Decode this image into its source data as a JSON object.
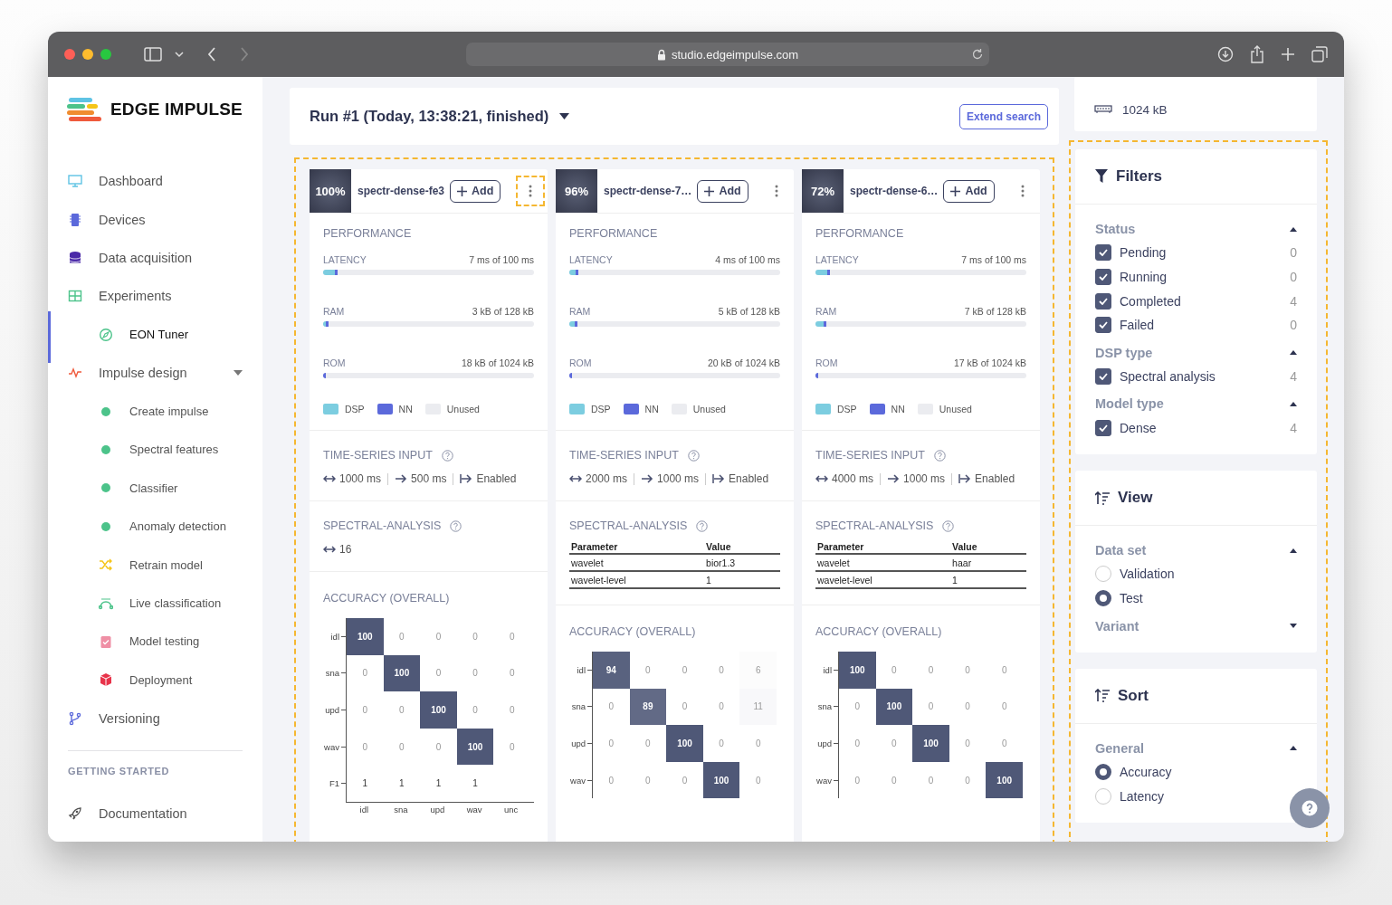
{
  "browser": {
    "url": "studio.edgeimpulse.com"
  },
  "sidebar": {
    "logo": "EDGE IMPULSE",
    "items": [
      {
        "label": "Dashboard",
        "selected": false
      },
      {
        "label": "Devices",
        "selected": false
      },
      {
        "label": "Data acquisition",
        "selected": false
      },
      {
        "label": "Experiments",
        "selected": false,
        "children": [
          {
            "label": "EON Tuner",
            "selected": true
          }
        ]
      },
      {
        "label": "Impulse design",
        "selected": false,
        "expanded": true,
        "children": [
          {
            "label": "Create impulse",
            "selected": false
          },
          {
            "label": "Spectral features",
            "selected": false
          },
          {
            "label": "Classifier",
            "selected": false
          },
          {
            "label": "Anomaly detection",
            "selected": false
          },
          {
            "label": "Retrain model",
            "selected": false
          },
          {
            "label": "Live classification",
            "selected": false
          },
          {
            "label": "Model testing",
            "selected": false
          },
          {
            "label": "Deployment",
            "selected": false
          }
        ]
      },
      {
        "label": "Versioning",
        "selected": false
      }
    ],
    "section_title": "GETTING STARTED",
    "footer_items": [
      {
        "label": "Documentation",
        "selected": false
      }
    ]
  },
  "header": {
    "run_title": "Run #1 (Today, 13:38:21, finished)",
    "extend_button": "Extend search"
  },
  "results": {
    "highlighted": true,
    "cards": [
      {
        "score": "100%",
        "name": "spectr-dense-fe3",
        "add": "Add",
        "menu_highlighted": true,
        "performance": {
          "title": "PERFORMANCE",
          "metrics": [
            {
              "label": "LATENCY",
              "reading": "7 ms of 100 ms",
              "segments": [
                {
                  "kind": "dsp",
                  "level": 0.055
                },
                {
                  "kind": "nn",
                  "level": 0.012
                }
              ]
            },
            {
              "label": "RAM",
              "reading": "3 kB of 128 kB",
              "segments": [
                {
                  "kind": "dsp",
                  "level": 0.004
                },
                {
                  "kind": "nn",
                  "level": 0.01
                }
              ]
            },
            {
              "label": "ROM",
              "reading": "18 kB of 1024 kB",
              "segments": [
                {
                  "kind": "nn",
                  "level": 0.012
                }
              ]
            }
          ],
          "legend": [
            {
              "label": "DSP",
              "color": "#7ccde0"
            },
            {
              "label": "NN",
              "color": "#5b69db"
            },
            {
              "label": "Unused",
              "color": "#ebecf0"
            }
          ]
        },
        "time_series": {
          "title": "TIME-SERIES INPUT",
          "items": [
            {
              "kind": "window",
              "text": "1000 ms"
            },
            {
              "kind": "stride",
              "text": "500 ms"
            },
            {
              "kind": "flag",
              "text": "Enabled"
            }
          ]
        },
        "spectral": {
          "title": "SPECTRAL-ANALYSIS",
          "kind": "value",
          "value": "16"
        },
        "accuracy": {
          "title": "ACCURACY (OVERALL)",
          "x_axis_labels": [
            "idl",
            "sna",
            "upd",
            "wav",
            "unc"
          ],
          "rows": [
            {
              "label": "idl",
              "kind": "class",
              "cells": [
                "100",
                "0",
                "0",
                "0",
                "0"
              ]
            },
            {
              "label": "sna",
              "kind": "class",
              "cells": [
                "0",
                "100",
                "0",
                "0",
                "0"
              ]
            },
            {
              "label": "upd",
              "kind": "class",
              "cells": [
                "0",
                "0",
                "100",
                "0",
                "0"
              ]
            },
            {
              "label": "wav",
              "kind": "class",
              "cells": [
                "0",
                "0",
                "0",
                "100",
                "0"
              ]
            },
            {
              "label": "F1",
              "kind": "f1",
              "cells": [
                "1",
                "1",
                "1",
                "1"
              ]
            }
          ]
        }
      },
      {
        "score": "96%",
        "name": "spectr-dense-7…",
        "add": "Add",
        "menu_highlighted": false,
        "performance": {
          "title": "PERFORMANCE",
          "metrics": [
            {
              "label": "LATENCY",
              "reading": "4 ms of 100 ms",
              "segments": [
                {
                  "kind": "dsp",
                  "level": 0.03
                },
                {
                  "kind": "nn",
                  "level": 0.01
                }
              ]
            },
            {
              "label": "RAM",
              "reading": "5 kB of 128 kB",
              "segments": [
                {
                  "kind": "dsp",
                  "level": 0.025
                },
                {
                  "kind": "nn",
                  "level": 0.012
                }
              ]
            },
            {
              "label": "ROM",
              "reading": "20 kB of 1024 kB",
              "segments": [
                {
                  "kind": "nn",
                  "level": 0.015
                }
              ]
            }
          ],
          "legend": [
            {
              "label": "DSP",
              "color": "#7ccde0"
            },
            {
              "label": "NN",
              "color": "#5b69db"
            },
            {
              "label": "Unused",
              "color": "#ebecf0"
            }
          ]
        },
        "time_series": {
          "title": "TIME-SERIES INPUT",
          "items": [
            {
              "kind": "window",
              "text": "2000 ms"
            },
            {
              "kind": "stride",
              "text": "1000 ms"
            },
            {
              "kind": "flag",
              "text": "Enabled"
            }
          ]
        },
        "spectral": {
          "title": "SPECTRAL-ANALYSIS",
          "kind": "table",
          "columns": [
            "Parameter",
            "Value"
          ],
          "rows": [
            [
              "wavelet",
              "bior1.3"
            ],
            [
              "wavelet-level",
              "1"
            ]
          ]
        },
        "accuracy": {
          "title": "ACCURACY (OVERALL)",
          "rows": [
            {
              "label": "idl",
              "kind": "class",
              "cells": [
                "94",
                "0",
                "0",
                "0",
                "6"
              ]
            },
            {
              "label": "sna",
              "kind": "class",
              "cells": [
                "0",
                "89",
                "0",
                "0",
                "11"
              ]
            },
            {
              "label": "upd",
              "kind": "class",
              "cells": [
                "0",
                "0",
                "100",
                "0",
                "0"
              ]
            },
            {
              "label": "wav",
              "kind": "class",
              "cells": [
                "0",
                "0",
                "0",
                "100",
                "0"
              ]
            }
          ]
        }
      },
      {
        "score": "72%",
        "name": "spectr-dense-6…",
        "add": "Add",
        "menu_highlighted": false,
        "performance": {
          "title": "PERFORMANCE",
          "metrics": [
            {
              "label": "LATENCY",
              "reading": "7 ms of 100 ms",
              "segments": [
                {
                  "kind": "dsp",
                  "level": 0.055
                },
                {
                  "kind": "nn",
                  "level": 0.012
                }
              ]
            },
            {
              "label": "RAM",
              "reading": "7 kB of 128 kB",
              "segments": [
                {
                  "kind": "dsp",
                  "level": 0.04
                },
                {
                  "kind": "nn",
                  "level": 0.012
                }
              ]
            },
            {
              "label": "ROM",
              "reading": "17 kB of 1024 kB",
              "segments": [
                {
                  "kind": "nn",
                  "level": 0.012
                }
              ]
            }
          ],
          "legend": [
            {
              "label": "DSP",
              "color": "#7ccde0"
            },
            {
              "label": "NN",
              "color": "#5b69db"
            },
            {
              "label": "Unused",
              "color": "#ebecf0"
            }
          ]
        },
        "time_series": {
          "title": "TIME-SERIES INPUT",
          "items": [
            {
              "kind": "window",
              "text": "4000 ms"
            },
            {
              "kind": "stride",
              "text": "1000 ms"
            },
            {
              "kind": "flag",
              "text": "Enabled"
            }
          ]
        },
        "spectral": {
          "title": "SPECTRAL-ANALYSIS",
          "kind": "table",
          "columns": [
            "Parameter",
            "Value"
          ],
          "rows": [
            [
              "wavelet",
              "haar"
            ],
            [
              "wavelet-level",
              "1"
            ]
          ]
        },
        "accuracy": {
          "title": "ACCURACY (OVERALL)",
          "rows": [
            {
              "label": "idl",
              "kind": "class",
              "cells": [
                "100",
                "0",
                "0",
                "0",
                "0"
              ]
            },
            {
              "label": "sna",
              "kind": "class",
              "cells": [
                "0",
                "100",
                "0",
                "0",
                "0"
              ]
            },
            {
              "label": "upd",
              "kind": "class",
              "cells": [
                "0",
                "0",
                "100",
                "0",
                "0"
              ]
            },
            {
              "label": "wav",
              "kind": "class",
              "cells": [
                "0",
                "0",
                "0",
                "0",
                "100"
              ]
            }
          ]
        }
      }
    ]
  },
  "target_card": {
    "rom": "1024 kB"
  },
  "side_panel": {
    "highlighted": true,
    "filters": {
      "title": "Filters",
      "groups": [
        {
          "title": "Status",
          "expanded": true,
          "items": [
            {
              "label": "Pending",
              "count": "0",
              "checked": true
            },
            {
              "label": "Running",
              "count": "0",
              "checked": true
            },
            {
              "label": "Completed",
              "count": "4",
              "checked": true
            },
            {
              "label": "Failed",
              "count": "0",
              "checked": true
            }
          ]
        },
        {
          "title": "DSP type",
          "expanded": true,
          "items": [
            {
              "label": "Spectral analysis",
              "count": "4",
              "checked": true
            }
          ]
        },
        {
          "title": "Model type",
          "expanded": true,
          "items": [
            {
              "label": "Dense",
              "count": "4",
              "checked": true
            }
          ]
        }
      ]
    },
    "view": {
      "title": "View",
      "groups": [
        {
          "title": "Data set",
          "expanded": true,
          "options": [
            {
              "label": "Validation",
              "selected": false
            },
            {
              "label": "Test",
              "selected": true
            }
          ]
        },
        {
          "title": "Variant",
          "expanded": false
        }
      ]
    },
    "sort": {
      "title": "Sort",
      "groups": [
        {
          "title": "General",
          "expanded": true,
          "options": [
            {
              "label": "Accuracy",
              "selected": true
            },
            {
              "label": "Latency",
              "selected": false
            }
          ]
        }
      ]
    }
  }
}
